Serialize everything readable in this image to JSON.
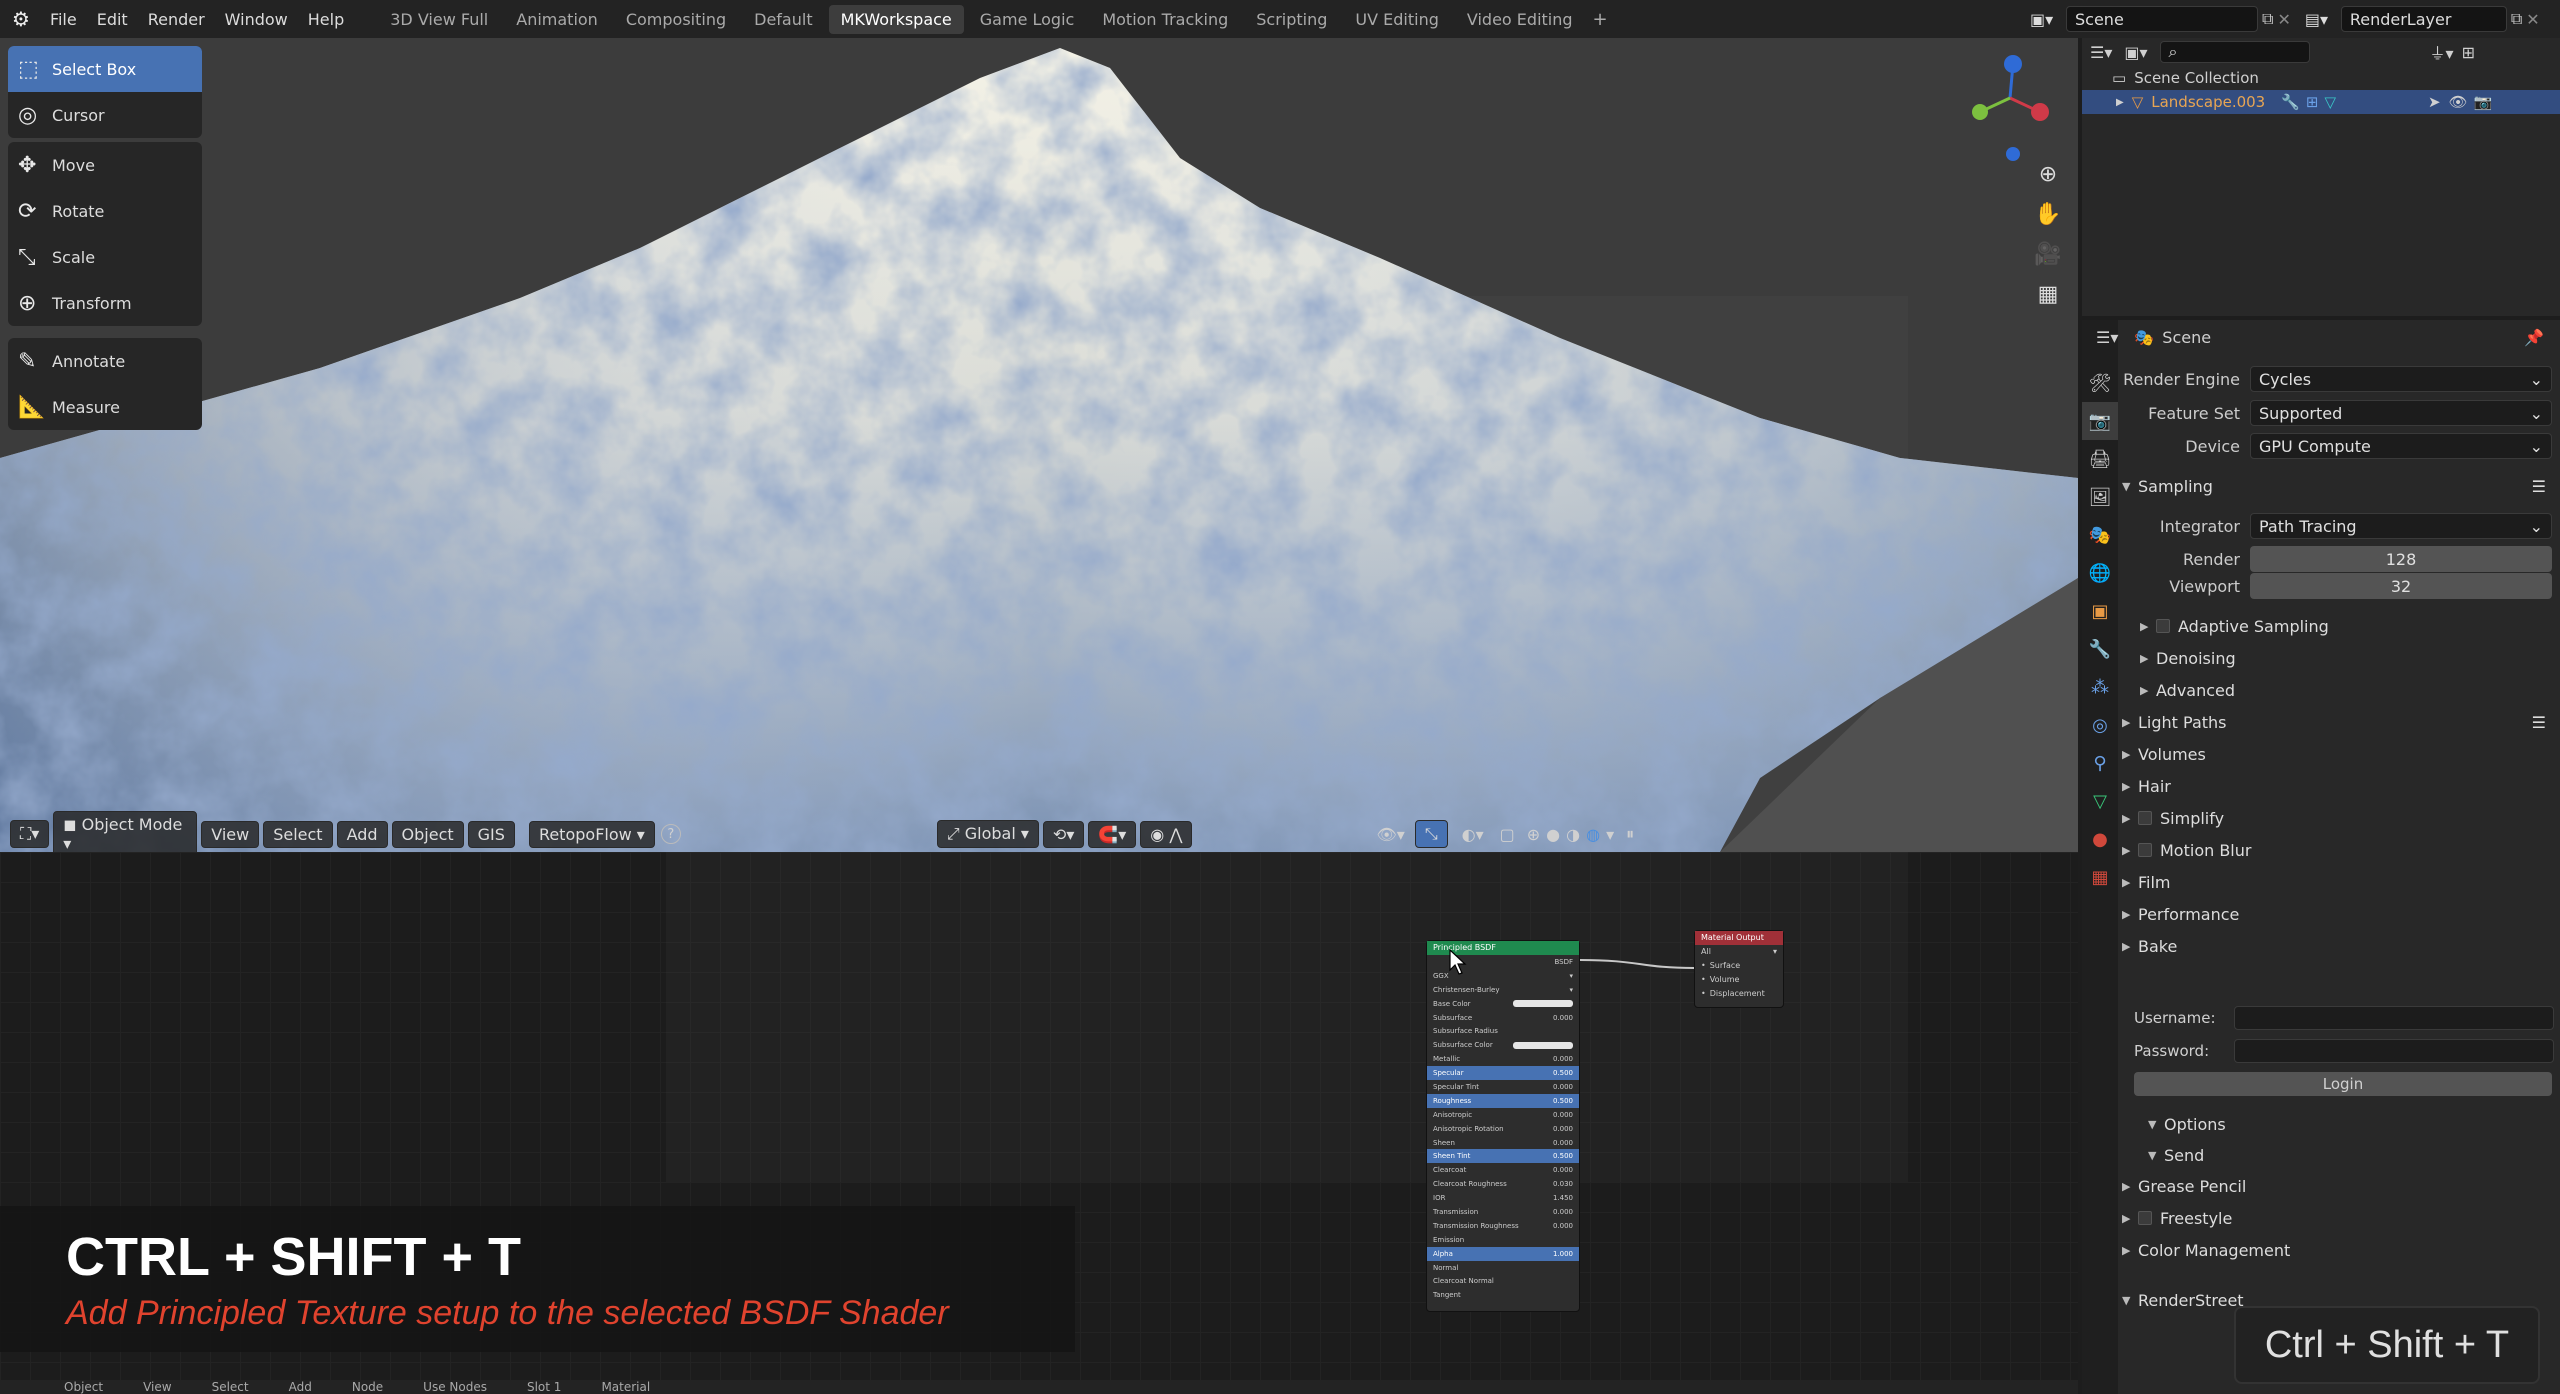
{
  "topbar": {
    "menu": [
      "File",
      "Edit",
      "Render",
      "Window",
      "Help"
    ],
    "workspaces": [
      "3D View Full",
      "Animation",
      "Compositing",
      "Default",
      "MKWorkspace",
      "Game Logic",
      "Motion Tracking",
      "Scripting",
      "UV Editing",
      "Video Editing"
    ],
    "active_workspace": "MKWorkspace",
    "add_tab": "+",
    "scene_name": "Scene",
    "render_layer": "RenderLayer"
  },
  "toolbar": {
    "groups": [
      [
        {
          "label": "Select Box",
          "icon": "select-box-icon",
          "glyph": "⬚",
          "active": true
        },
        {
          "label": "Cursor",
          "icon": "cursor-icon",
          "glyph": "◎",
          "active": false
        }
      ],
      [
        {
          "label": "Move",
          "icon": "move-icon",
          "glyph": "✥",
          "active": false
        },
        {
          "label": "Rotate",
          "icon": "rotate-icon",
          "glyph": "⟳",
          "active": false
        },
        {
          "label": "Scale",
          "icon": "scale-icon",
          "glyph": "⤡",
          "active": false
        },
        {
          "label": "Transform",
          "icon": "transform-icon",
          "glyph": "⊕",
          "active": false
        }
      ],
      [
        {
          "label": "Annotate",
          "icon": "annotate-icon",
          "glyph": "✎",
          "active": false
        },
        {
          "label": "Measure",
          "icon": "measure-icon",
          "glyph": "📐",
          "active": false
        }
      ]
    ]
  },
  "viewport_header": {
    "mode": "Object Mode",
    "menus": [
      "View",
      "Select",
      "Add",
      "Object",
      "GIS"
    ],
    "addon": "RetopoFlow",
    "help": "?",
    "orientation": "Global"
  },
  "nodes": {
    "bsdf": {
      "title": "Principled BSDF",
      "output": "BSDF",
      "distribution": "GGX",
      "subsurface_method": "Christensen-Burley",
      "inputs": [
        {
          "label": "Base Color",
          "value": "",
          "hl": false
        },
        {
          "label": "Subsurface",
          "value": "0.000",
          "hl": false
        },
        {
          "label": "Subsurface Radius",
          "value": "",
          "hl": false
        },
        {
          "label": "Subsurface Color",
          "value": "",
          "hl": false
        },
        {
          "label": "Metallic",
          "value": "0.000",
          "hl": false
        },
        {
          "label": "Specular",
          "value": "0.500",
          "hl": true
        },
        {
          "label": "Specular Tint",
          "value": "0.000",
          "hl": false
        },
        {
          "label": "Roughness",
          "value": "0.500",
          "hl": true
        },
        {
          "label": "Anisotropic",
          "value": "0.000",
          "hl": false
        },
        {
          "label": "Anisotropic Rotation",
          "value": "0.000",
          "hl": false
        },
        {
          "label": "Sheen",
          "value": "0.000",
          "hl": false
        },
        {
          "label": "Sheen Tint",
          "value": "0.500",
          "hl": true
        },
        {
          "label": "Clearcoat",
          "value": "0.000",
          "hl": false
        },
        {
          "label": "Clearcoat Roughness",
          "value": "0.030",
          "hl": false
        },
        {
          "label": "IOR",
          "value": "1.450",
          "hl": false
        },
        {
          "label": "Transmission",
          "value": "0.000",
          "hl": false
        },
        {
          "label": "Transmission Roughness",
          "value": "0.000",
          "hl": false
        },
        {
          "label": "Emission",
          "value": "",
          "hl": false
        },
        {
          "label": "Alpha",
          "value": "1.000",
          "hl": true
        },
        {
          "label": "Normal",
          "value": "",
          "hl": false
        },
        {
          "label": "Clearcoat Normal",
          "value": "",
          "hl": false
        },
        {
          "label": "Tangent",
          "value": "",
          "hl": false
        }
      ]
    },
    "output": {
      "title": "Material Output",
      "target": "All",
      "inputs": [
        "Surface",
        "Volume",
        "Displacement"
      ]
    }
  },
  "caption": {
    "title": "CTRL + SHIFT + T",
    "subtitle": "Add Principled Texture setup to the selected BSDF Shader"
  },
  "key_badge": "Ctrl + Shift + T",
  "node_header": {
    "items": [
      "Object",
      "View",
      "Select",
      "Add",
      "Node",
      "Use Nodes",
      "Slot 1",
      "Material"
    ]
  },
  "outliner": {
    "collection": "Scene Collection",
    "object": "Landscape.003"
  },
  "properties": {
    "context": "Scene",
    "render_engine_label": "Render Engine",
    "render_engine": "Cycles",
    "feature_set_label": "Feature Set",
    "feature_set": "Supported",
    "device_label": "Device",
    "device": "GPU Compute",
    "sampling": {
      "title": "Sampling",
      "integrator_label": "Integrator",
      "integrator": "Path Tracing",
      "render_label": "Render",
      "render": "128",
      "viewport_label": "Viewport",
      "viewport": "32",
      "subpanels": [
        "Adaptive Sampling",
        "Denoising",
        "Advanced"
      ]
    },
    "panels_a": [
      {
        "label": "Light Paths",
        "checkbox": false
      },
      {
        "label": "Volumes",
        "checkbox": false
      },
      {
        "label": "Hair",
        "checkbox": false
      },
      {
        "label": "Simplify",
        "checkbox": true
      },
      {
        "label": "Motion Blur",
        "checkbox": true
      },
      {
        "label": "Film",
        "checkbox": false
      },
      {
        "label": "Performance",
        "checkbox": false
      },
      {
        "label": "Bake",
        "checkbox": false
      }
    ],
    "renderstreet": {
      "title": "RenderStreet",
      "username_label": "Username:",
      "password_label": "Password:",
      "login": "Login",
      "options": "Options",
      "send": "Send"
    },
    "panels_b": [
      {
        "label": "Grease Pencil",
        "checkbox": false
      },
      {
        "label": "Freestyle",
        "checkbox": true
      },
      {
        "label": "Color Management",
        "checkbox": false
      }
    ]
  }
}
